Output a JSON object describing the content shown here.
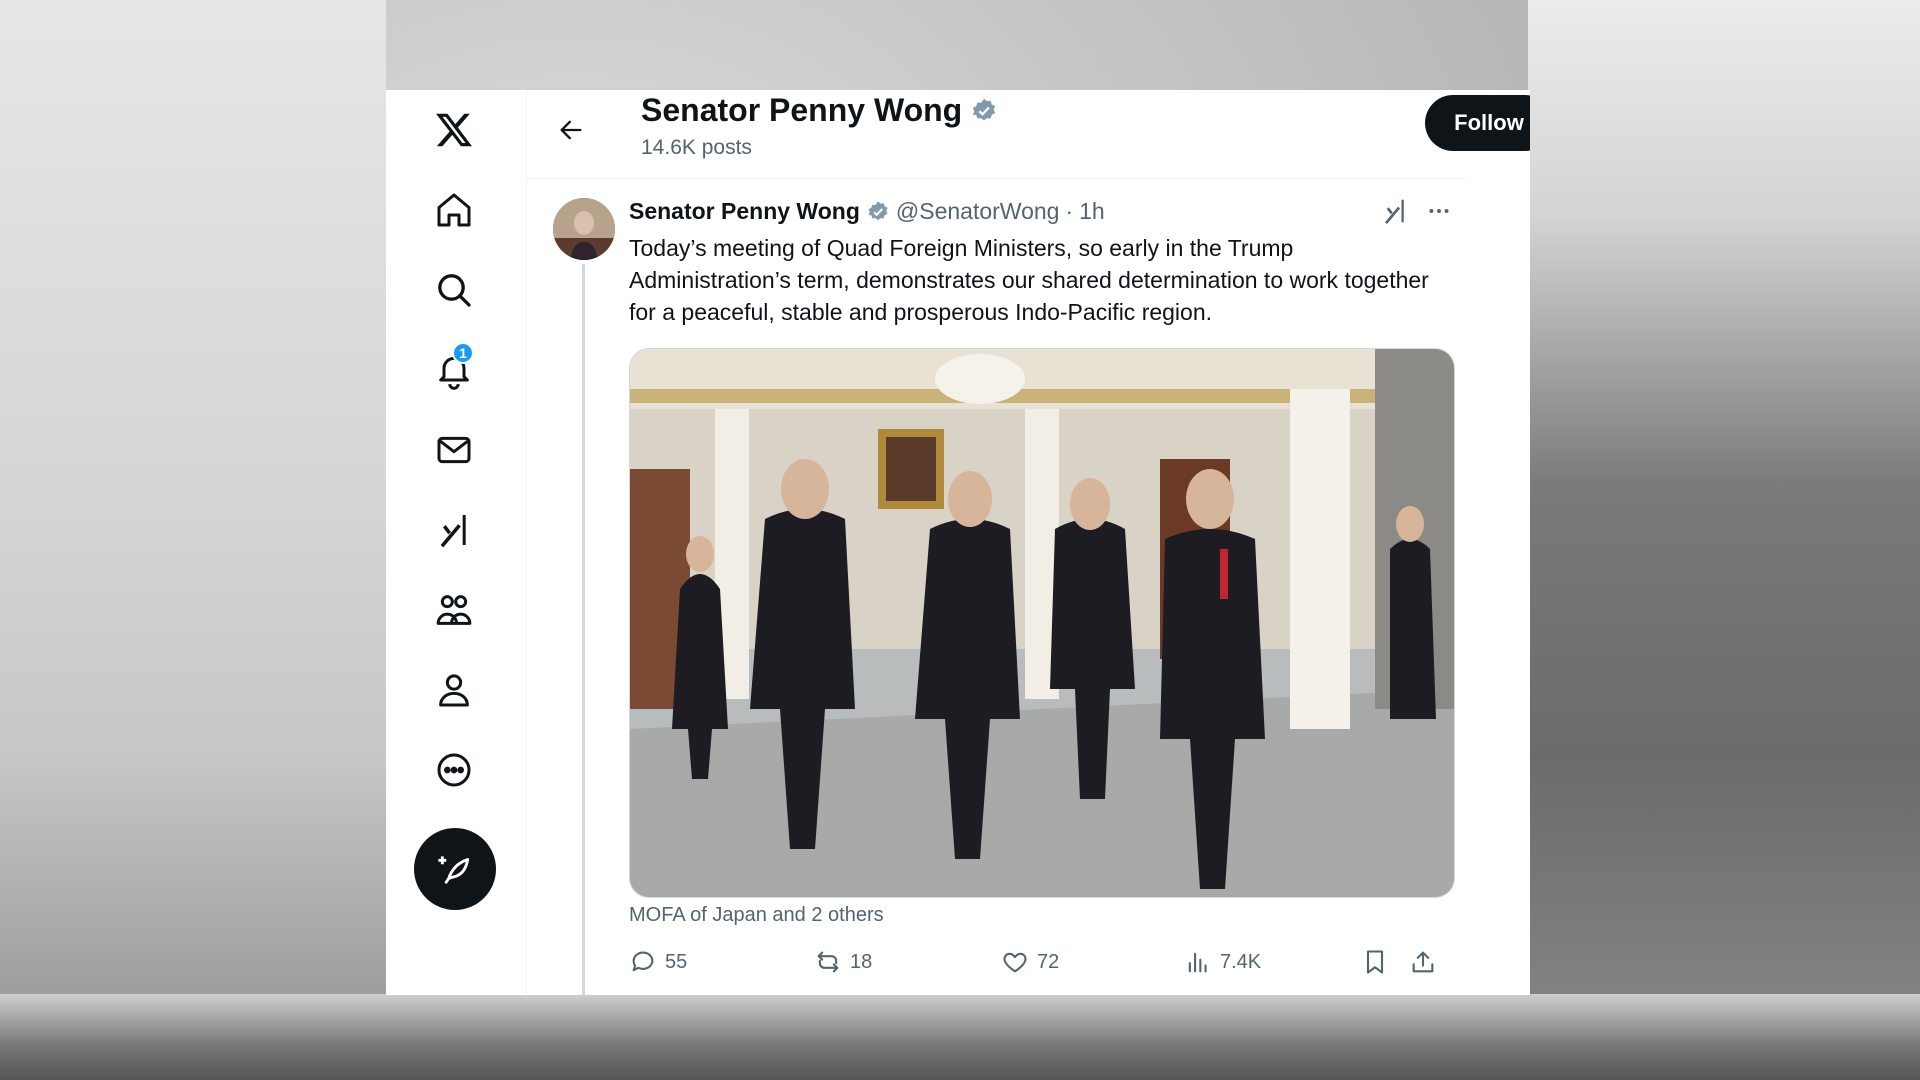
{
  "profile_header": {
    "name": "Senator Penny Wong",
    "posts_count": "14.6K posts",
    "follow_label": "Follow"
  },
  "nav": {
    "notifications_badge": "1",
    "items": [
      "x-logo-icon",
      "home-icon",
      "search-icon",
      "notifications-icon",
      "messages-icon",
      "grok-icon",
      "communities-icon",
      "profile-icon",
      "more-icon",
      "compose-post-icon"
    ]
  },
  "tweet": {
    "author_name": "Senator Penny Wong",
    "handle": "@SenatorWong",
    "separator": "·",
    "time": "1h",
    "text": "Today’s meeting of Quad Foreign Ministers, so early in the Trump Administration’s term, demonstrates our shared determination to work together for a peaceful, stable and prosperous Indo-Pacific region.",
    "tagged": "MOFA of Japan and 2 others",
    "replies": "55",
    "reposts": "18",
    "likes": "72",
    "views": "7.4K"
  },
  "colors": {
    "accent": "#1d9bf0",
    "text": "#0f1419",
    "secondary": "#536471",
    "verified": "#829aab"
  }
}
